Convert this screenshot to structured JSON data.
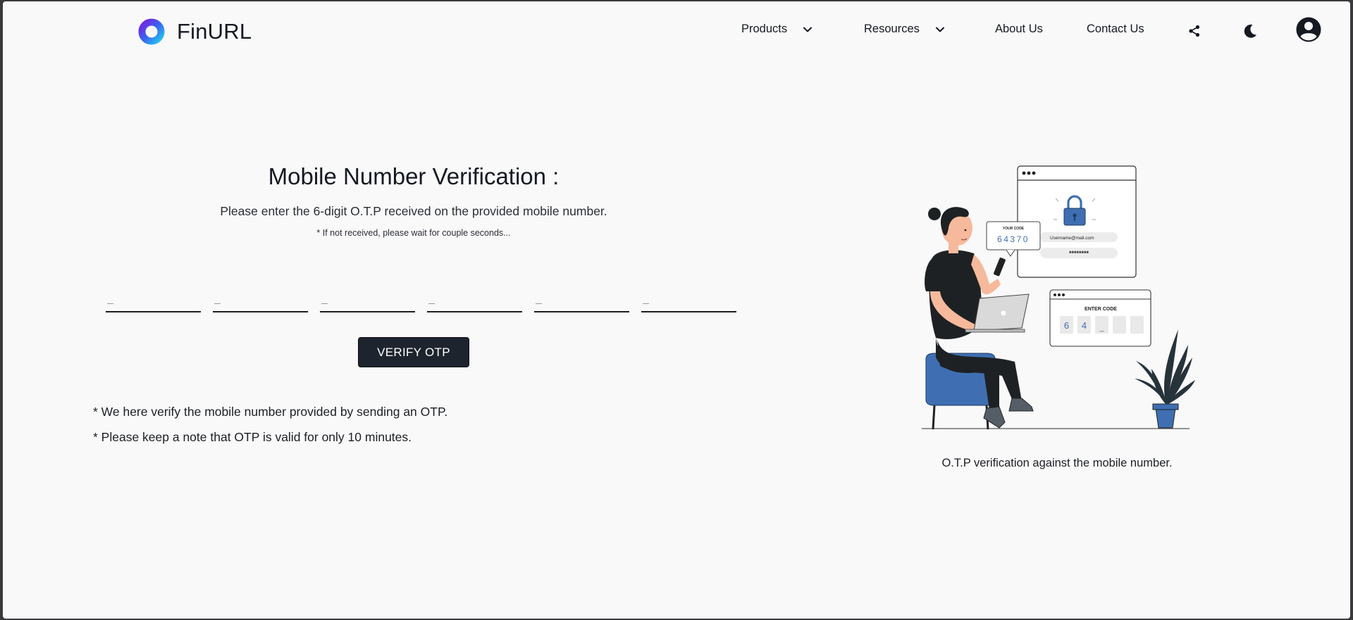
{
  "brand": {
    "name": "FinURL"
  },
  "nav": {
    "products": "Products",
    "resources": "Resources",
    "about": "About Us",
    "contact": "Contact Us"
  },
  "main": {
    "title": "Mobile Number Verification :",
    "subtitle": "Please enter the 6-digit O.T.P received on the provided mobile number.",
    "hint": "* If not received, please wait for couple seconds...",
    "otp_placeholder": "_",
    "verify_label": "VERIFY OTP",
    "notes": [
      "* We here verify the mobile number provided by sending an OTP.",
      "* Please keep a note that OTP is valid for only 10 minutes."
    ]
  },
  "illustration": {
    "your_code_label": "YOUR CODE",
    "code": "64370",
    "username": "Username@mail.com",
    "password_mask": "********",
    "enter_code_label": "ENTER CODE",
    "entered_digits": [
      "6",
      "4",
      "_"
    ],
    "caption": "O.T.P verification against the mobile number."
  },
  "colors": {
    "background": "#f9f9f9",
    "text": "#151922",
    "button": "#1d242d",
    "illustration_accent": "#3f6fb2",
    "logo_gradient": [
      "#7b1fe0",
      "#23c6f0"
    ]
  },
  "icons": {
    "share": "share-icon",
    "theme": "moon-icon",
    "profile": "account-circle-icon",
    "dropdown": "chevron-down-icon"
  }
}
